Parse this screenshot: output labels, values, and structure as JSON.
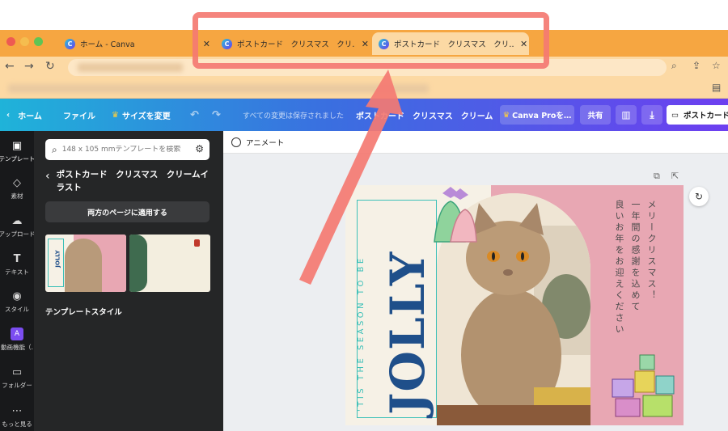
{
  "browser": {
    "tabs": [
      {
        "title": "ホーム - Canva",
        "active": false
      },
      {
        "title": "ポストカード　クリスマス　クリ…",
        "active": false
      },
      {
        "title": "ポストカード　クリスマス　クリ…",
        "active": true
      }
    ],
    "favicon_letter": "C",
    "colors": {
      "tabbar": "#f6a641",
      "addressbar": "#fcd9a4",
      "highlight": "#f47a72"
    }
  },
  "toolbar": {
    "home": "ホーム",
    "file": "ファイル",
    "resize": "サイズを変更",
    "saved_status": "すべての変更は保存されました",
    "doc_title": "ポストカード　クリスマス　クリーム…",
    "pro_button": "Canva Proを…",
    "share": "共有",
    "right_button": "ポストカード"
  },
  "rail": {
    "items": [
      {
        "label": "テンプレート",
        "icon": "template-icon"
      },
      {
        "label": "素材",
        "icon": "elements-icon"
      },
      {
        "label": "アップロード",
        "icon": "upload-icon"
      },
      {
        "label": "テキスト",
        "icon": "text-icon"
      },
      {
        "label": "スタイル",
        "icon": "style-icon"
      },
      {
        "label": "動画機能（…",
        "icon": "video-icon"
      },
      {
        "label": "フォルダー",
        "icon": "folder-icon"
      },
      {
        "label": "もっと見る",
        "icon": "more-icon"
      }
    ]
  },
  "panel": {
    "search_placeholder": "148 x 105 mmテンプレートを検索",
    "template_title": "ポストカード　クリスマス　クリームイラスト",
    "apply_button": "両方のページに適用する",
    "section_label": "テンプレートスタイル"
  },
  "canvas": {
    "animate": "アニメート"
  },
  "postcard": {
    "vertical_subtitle": "'TIS THE SEASON TO BE",
    "headline": "JOLLY",
    "jp_lines": [
      "メリークリスマス！",
      "一年間の感謝を込めて",
      "良いお年をお迎えください"
    ],
    "colors": {
      "teal": "#3cc0b8",
      "navy": "#1f4f8a",
      "pink": "#e8a7b3",
      "cream": "#f6f1e6"
    }
  }
}
